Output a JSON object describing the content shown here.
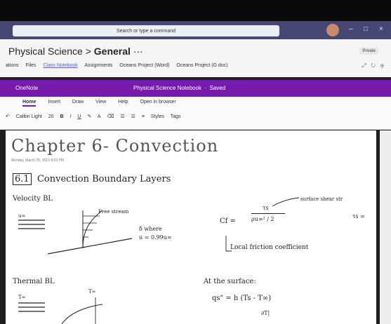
{
  "teams": {
    "search_placeholder": "Search or type a command",
    "min_label": "–",
    "max_label": "□",
    "close_label": "×"
  },
  "channel": {
    "team": "Physical Science",
    "separator": ">",
    "name": "General",
    "more": "···",
    "privacy": "Private",
    "tabs": [
      "ations",
      "Files",
      "Class Notebook",
      "Assignments",
      "Oceans Project (Word)",
      "Oceans Project (G doc)"
    ]
  },
  "onenote": {
    "app_name": "OneNote",
    "notebook": "Physical Science Notebook",
    "status": "Saved",
    "ribbon_tabs": [
      "Home",
      "Insert",
      "Draw",
      "View",
      "Help",
      "Open in browser"
    ],
    "font": "Calibri Light",
    "size": "20",
    "styles_label": "Styles",
    "tags_label": "Tags"
  },
  "page": {
    "title": "Chapter 6- Convection",
    "date": "Monday, March 25, 2013   8:03 PM"
  },
  "notes": {
    "section": "6.1",
    "heading": "Convection Boundary Layers",
    "velocity": "Velocity BL",
    "u_inf": "u∞",
    "free_stream": "Free stream",
    "delta_where": "δ where",
    "delta_eq": "u = 0.99u∞",
    "cf_lhs": "Cf =",
    "cf_num": "τs",
    "cf_den": "ρu∞² / 2",
    "surface_shear": "surface shear str",
    "tau_s": "τs =",
    "local_friction": "Local friction coefficient",
    "thermal": "Thermal BL",
    "t_inf": "T∞",
    "at_surface": "At the surface:",
    "q_eq": "qs\" = h (Ts - T∞)",
    "dt": "∂T|"
  }
}
